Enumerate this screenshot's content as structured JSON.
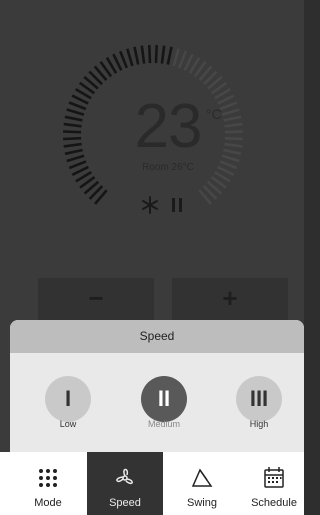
{
  "thermostat": {
    "temperature": "23",
    "unit": "°C",
    "room": "Room 26°C",
    "mode_icon": "snowflake-icon",
    "status_icon": "pause-icon"
  },
  "controls": {
    "decrease_label": "−",
    "increase_label": "+"
  },
  "speed_sheet": {
    "title": "Speed",
    "options": [
      {
        "symbol": "I",
        "label": "Low",
        "selected": false
      },
      {
        "symbol": "II",
        "label": "Medium",
        "selected": true
      },
      {
        "symbol": "III",
        "label": "High",
        "selected": false
      }
    ]
  },
  "tabs": [
    {
      "label": "Mode",
      "icon": "grid-dots-icon",
      "active": false
    },
    {
      "label": "Speed",
      "icon": "fan-icon",
      "active": true
    },
    {
      "label": "Swing",
      "icon": "swing-icon",
      "active": false
    },
    {
      "label": "Schedule",
      "icon": "calendar-icon",
      "active": false
    }
  ],
  "colors": {
    "overlay": "#3b3b3b",
    "active_tab": "#333333",
    "selected_speed": "#595959"
  }
}
